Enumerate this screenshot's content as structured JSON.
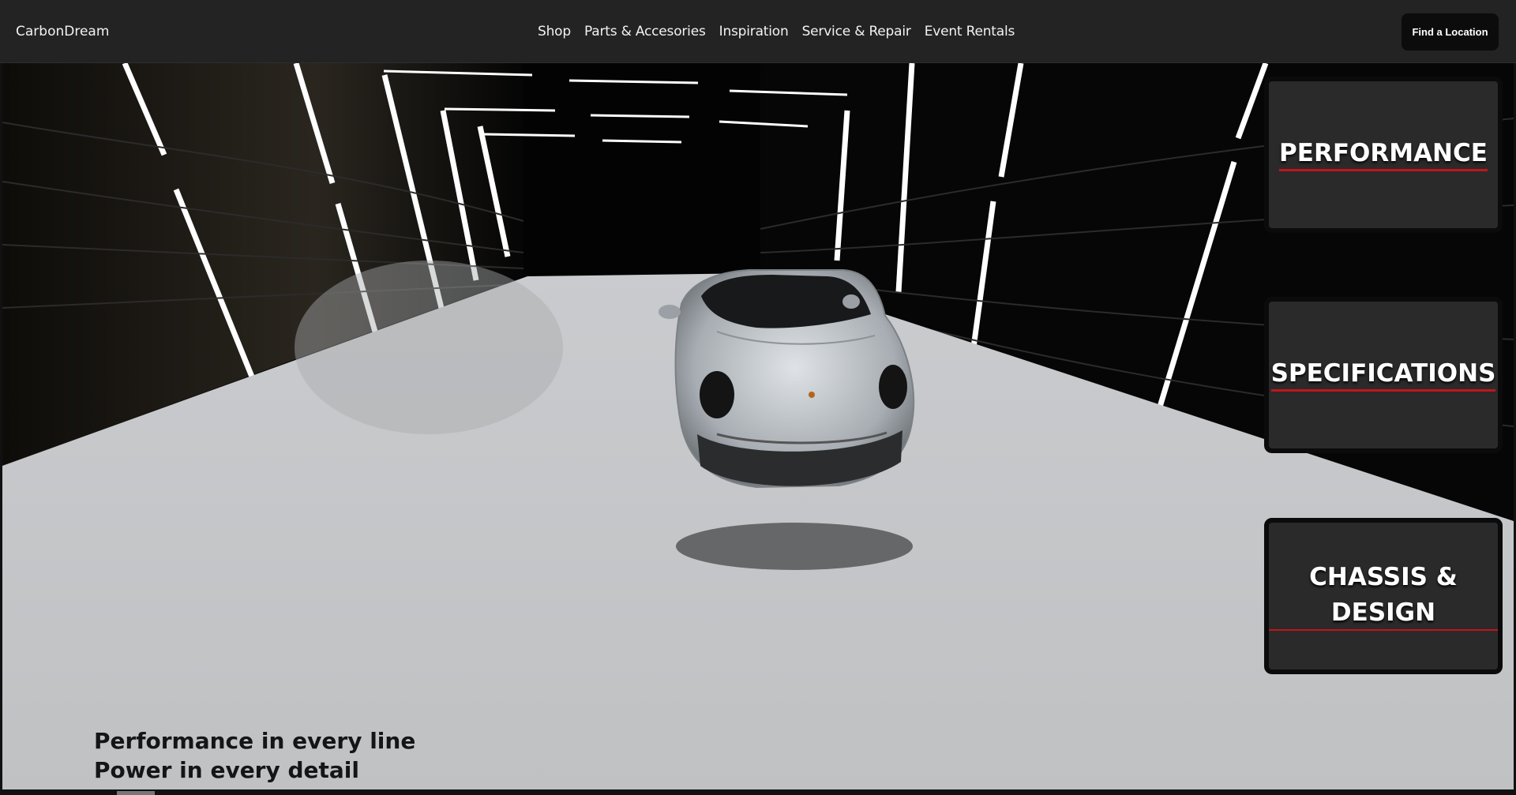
{
  "nav": {
    "brand": "CarbonDream",
    "links": [
      "Shop",
      "Parts & Accesories",
      "Inspiration",
      "Service & Repair",
      "Event Rentals"
    ],
    "cta": "Find a Location"
  },
  "hero": {
    "tagline_line1": "Performance in every line",
    "tagline_line2": "Power in every detail"
  },
  "cards": {
    "performance": "PERFORMANCE",
    "specifications": "SPECIFICATIONS",
    "chassis_line1": "CHASSIS &",
    "chassis_line2": "DESIGN"
  },
  "colors": {
    "accent": "#c4141c",
    "nav_bg": "#232323",
    "card_bg": "#2a2a2a",
    "floor": "#c9cbcd"
  }
}
